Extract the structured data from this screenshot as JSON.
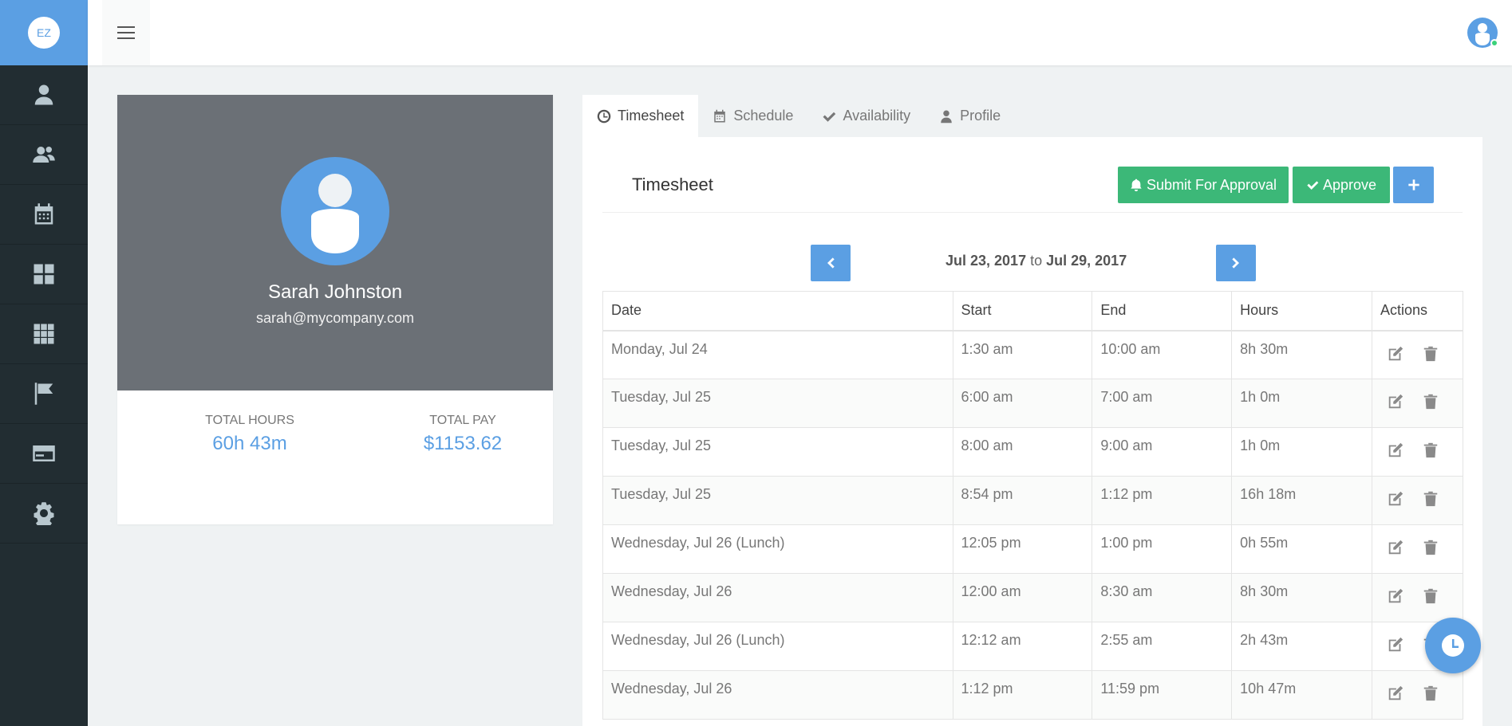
{
  "brand": {
    "logo_text": "EZ"
  },
  "sidebar": {
    "items": [
      {
        "icon": "user-icon"
      },
      {
        "icon": "users-icon"
      },
      {
        "icon": "calendar-icon"
      },
      {
        "icon": "dashboard-icon"
      },
      {
        "icon": "apps-grid-icon"
      },
      {
        "icon": "flag-icon"
      },
      {
        "icon": "credit-card-icon"
      },
      {
        "icon": "gear-icon"
      }
    ]
  },
  "profile": {
    "name": "Sarah Johnston",
    "email": "sarah@mycompany.com",
    "total_hours_label": "TOTAL HOURS",
    "total_hours": "60h 43m",
    "total_pay_label": "TOTAL PAY",
    "total_pay": "$1153.62"
  },
  "tabs": [
    {
      "label": "Timesheet",
      "icon": "clock-icon",
      "active": true
    },
    {
      "label": "Schedule",
      "icon": "calendar-icon"
    },
    {
      "label": "Availability",
      "icon": "check-icon"
    },
    {
      "label": "Profile",
      "icon": "user-icon"
    }
  ],
  "timesheet": {
    "title": "Timesheet",
    "submit_label": "Submit For Approval",
    "approve_label": "Approve",
    "range_start": "Jul 23, 2017",
    "range_to": "to",
    "range_end": "Jul 29, 2017",
    "columns": [
      "Date",
      "Start",
      "End",
      "Hours",
      "Actions"
    ],
    "rows": [
      {
        "date": "Monday, Jul 24",
        "start": "1:30 am",
        "end": "10:00 am",
        "hours": "8h 30m"
      },
      {
        "date": "Tuesday, Jul 25",
        "start": "6:00 am",
        "end": "7:00 am",
        "hours": "1h 0m"
      },
      {
        "date": "Tuesday, Jul 25",
        "start": "8:00 am",
        "end": "9:00 am",
        "hours": "1h 0m"
      },
      {
        "date": "Tuesday, Jul 25",
        "start": "8:54 pm",
        "end": "1:12 pm",
        "hours": "16h 18m"
      },
      {
        "date": "Wednesday, Jul 26 (Lunch)",
        "start": "12:05 pm",
        "end": "1:00 pm",
        "hours": "0h 55m"
      },
      {
        "date": "Wednesday, Jul 26",
        "start": "12:00 am",
        "end": "8:30 am",
        "hours": "8h 30m"
      },
      {
        "date": "Wednesday, Jul 26 (Lunch)",
        "start": "12:12 am",
        "end": "2:55 am",
        "hours": "2h 43m"
      },
      {
        "date": "Wednesday, Jul 26",
        "start": "1:12 pm",
        "end": "11:59 pm",
        "hours": "10h 47m"
      }
    ]
  },
  "colors": {
    "accent": "#5b9fe3",
    "success": "#3cb878",
    "sidebar": "#222d32"
  }
}
